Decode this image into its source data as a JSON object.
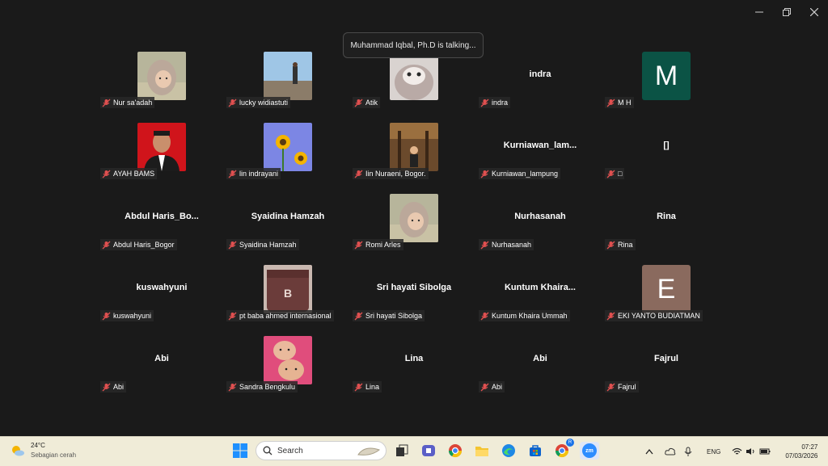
{
  "talking_banner": "Muhammad Iqbal, Ph.D is talking...",
  "participants": [
    {
      "tag": "Nur sa'adah",
      "avatar": "photo",
      "photo": "baby-hood"
    },
    {
      "tag": "lucky widiastuti",
      "avatar": "photo",
      "photo": "beach"
    },
    {
      "tag": "Atik",
      "avatar": "photo",
      "photo": "cat"
    },
    {
      "tag": "indra",
      "avatar": "name",
      "display": "indra"
    },
    {
      "tag": "M H",
      "avatar": "letter",
      "letter": "M",
      "color": "#0b5345"
    },
    {
      "tag": "AYAH BAMS",
      "avatar": "photo",
      "photo": "portrait-red"
    },
    {
      "tag": "lin indrayani",
      "avatar": "photo",
      "photo": "sunflowers"
    },
    {
      "tag": "Iin Nuraeni, Bogor.",
      "avatar": "photo",
      "photo": "park"
    },
    {
      "tag": "Kurniawan_lampung",
      "avatar": "name",
      "display": "Kurniawan_lam..."
    },
    {
      "tag": "□",
      "avatar": "name",
      "display": "[]"
    },
    {
      "tag": "Abdul Haris_Bogor",
      "avatar": "name",
      "display": "Abdul  Haris_Bo..."
    },
    {
      "tag": "Syaidina Hamzah",
      "avatar": "name",
      "display": "Syaidina Hamzah"
    },
    {
      "tag": "Romi Arles",
      "avatar": "photo",
      "photo": "baby-hood"
    },
    {
      "tag": "Nurhasanah",
      "avatar": "name",
      "display": "Nurhasanah"
    },
    {
      "tag": "Rina",
      "avatar": "name",
      "display": "Rina"
    },
    {
      "tag": "kuswahyuni",
      "avatar": "name",
      "display": "kuswahyuni"
    },
    {
      "tag": "pt baba ahmed internasional",
      "avatar": "photo",
      "photo": "bag"
    },
    {
      "tag": "Sri hayati Sibolga",
      "avatar": "name",
      "display": "Sri hayati Sibolga"
    },
    {
      "tag": "Kuntum Khaira Ummah",
      "avatar": "name",
      "display": "Kuntum  Khaira..."
    },
    {
      "tag": "EKI YANTO BUDIATMAN",
      "avatar": "letter",
      "letter": "E",
      "color": "#8a6a5e"
    },
    {
      "tag": "Abi",
      "avatar": "name",
      "display": "Abi"
    },
    {
      "tag": "Sandra Bengkulu",
      "avatar": "photo",
      "photo": "kids"
    },
    {
      "tag": "Lina",
      "avatar": "name",
      "display": "Lina"
    },
    {
      "tag": "Abi",
      "avatar": "name",
      "display": "Abi"
    },
    {
      "tag": "Fajrul",
      "avatar": "name",
      "display": "Fajrul"
    }
  ],
  "taskbar": {
    "weather_temp": "24°C",
    "weather_desc": "Sebagian cerah",
    "search_placeholder": "Search",
    "lang": "ENG",
    "time": "07:27",
    "date": "07/03/2026",
    "chrome_badge": "R",
    "zoom_label": "zm"
  },
  "icons": [
    "minimize-icon",
    "restore-icon",
    "close-icon",
    "mic-muted-icon",
    "windows-start-icon",
    "search-icon",
    "task-view-icon",
    "teams-icon",
    "chrome-icon",
    "file-explorer-icon",
    "edge-icon",
    "store-icon",
    "zoom-icon",
    "chevron-up-icon",
    "cloud-icon",
    "microphone-icon",
    "wifi-icon",
    "volume-icon",
    "battery-icon"
  ],
  "colors": {
    "background": "#1a1a1a",
    "muted_mic": "#e05050",
    "taskbar": "#f0ecd8"
  }
}
